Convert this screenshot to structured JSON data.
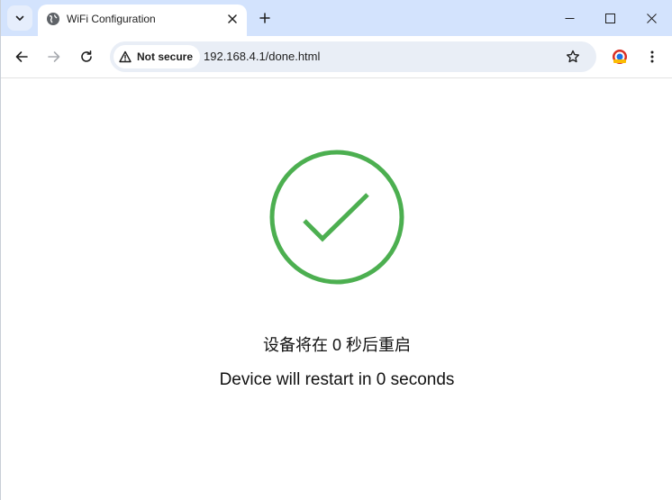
{
  "tab": {
    "title": "WiFi Configuration",
    "favicon_icon": "globe-icon"
  },
  "toolbar": {
    "security_label": "Not secure",
    "url": "192.168.4.1/done.html"
  },
  "page": {
    "status_icon": "checkmark-circle-icon",
    "message_cn": "设备将在 0 秒后重启",
    "message_en": "Device will restart in 0 seconds"
  },
  "colors": {
    "tabstrip_bg": "#d3e3fd",
    "success_green": "#4caf50",
    "omnibox_bg": "#e9eef6"
  }
}
